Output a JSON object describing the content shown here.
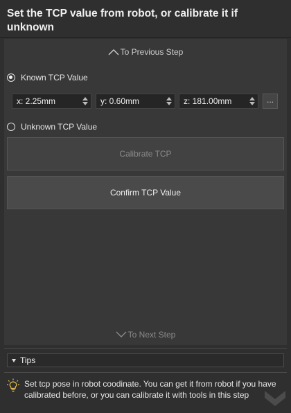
{
  "header": {
    "title": "Set the TCP value from robot, or calibrate it if unknown"
  },
  "nav": {
    "previous_label": "To Previous Step",
    "next_label": "To Next Step"
  },
  "options": {
    "known_label": "Known TCP Value",
    "known_selected": true,
    "unknown_label": "Unknown TCP Value",
    "unknown_selected": false
  },
  "tcp": {
    "x": "x: 2.25mm",
    "y": "y: 0.60mm",
    "z": "z: 181.00mm",
    "more_label": "..."
  },
  "buttons": {
    "calibrate_label": "Calibrate TCP",
    "confirm_label": "Confirm TCP Value"
  },
  "tips": {
    "header_label": "Tips",
    "text": "Set tcp pose in robot coodinate. You can get it from robot if you have calibrated before, or you can calibrate it with tools in this step"
  },
  "colors": {
    "background": "#2f2f2f",
    "panel": "#383838",
    "accent_icon": "#e8c350",
    "disabled_text": "#8a8a8a"
  },
  "icons": {
    "tip": "lightbulb-icon",
    "prev": "chevron-up-icon",
    "next": "chevron-down-icon"
  }
}
